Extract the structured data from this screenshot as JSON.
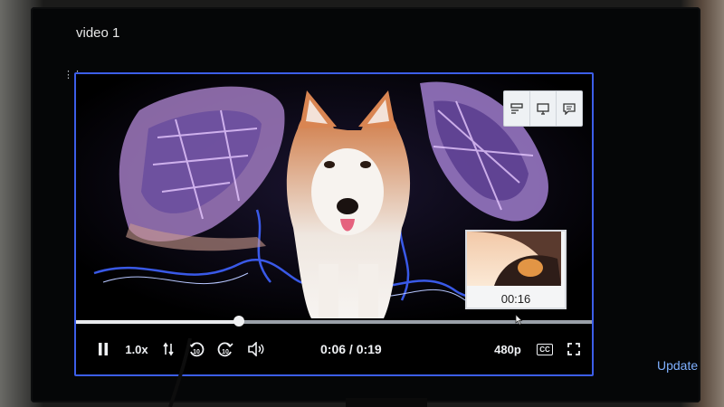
{
  "page": {
    "title": "video 1",
    "update_label": "Update"
  },
  "toolbar": {
    "items": [
      {
        "icon": "layout-compact-icon"
      },
      {
        "icon": "monitor-icon"
      },
      {
        "icon": "comment-icon"
      }
    ]
  },
  "thumbnail": {
    "time": "00:16"
  },
  "player": {
    "current_time": "0:06",
    "duration": "0:19",
    "time_display": "0:06 / 0:19",
    "progress_fraction": 0.316,
    "hover_fraction": 0.85,
    "speed": "1.0x",
    "quality": "480p",
    "cc_label": "CC",
    "colors": {
      "border": "#3c5ee8",
      "accent_link": "#7fb0ff"
    }
  }
}
